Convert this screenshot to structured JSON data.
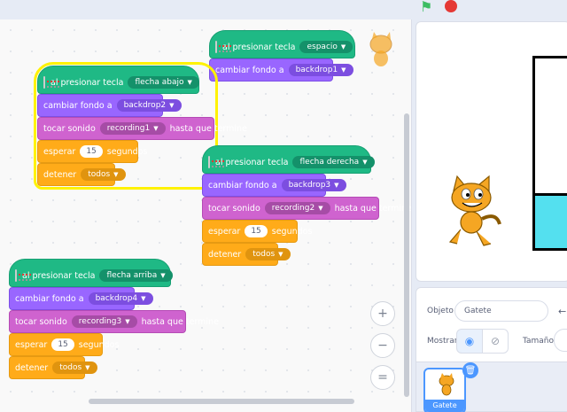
{
  "workspace": {
    "stack1": {
      "hat_label": "al presionar tecla",
      "hat_key": "espacio",
      "look_label": "cambiar fondo a",
      "look_value": "backdrop1"
    },
    "stack2": {
      "hat_label": "al presionar tecla",
      "hat_key": "flecha abajo",
      "look_label": "cambiar fondo a",
      "look_value": "backdrop2",
      "sound_label": "tocar sonido",
      "sound_value": "recording1",
      "sound_suffix": "hasta que termine",
      "wait_label": "esperar",
      "wait_value": "15",
      "wait_suffix": "segundos",
      "stop_label": "detener",
      "stop_value": "todos"
    },
    "stack3": {
      "hat_label": "al presionar tecla",
      "hat_key": "flecha derecha",
      "look_label": "cambiar fondo a",
      "look_value": "backdrop3",
      "sound_label": "tocar sonido",
      "sound_value": "recording2",
      "sound_suffix": "hasta que termine",
      "wait_label": "esperar",
      "wait_value": "15",
      "wait_suffix": "segundos",
      "stop_label": "detener",
      "stop_value": "todos"
    },
    "stack4": {
      "hat_label": "al presionar tecla",
      "hat_key": "flecha arriba",
      "look_label": "cambiar fondo a",
      "look_value": "backdrop4",
      "sound_label": "tocar sonido",
      "sound_value": "recording3",
      "sound_suffix": "hasta que termine",
      "wait_label": "esperar",
      "wait_value": "15",
      "wait_suffix": "segundos",
      "stop_label": "detener",
      "stop_value": "todos"
    },
    "zoom": {
      "in": "+",
      "out": "−",
      "reset": "="
    }
  },
  "sprite_panel": {
    "object_label": "Objeto",
    "object_name": "Gatete",
    "show_label": "Mostrar",
    "size_label": "Tamaño",
    "sprite_thumb_label": "Gatete"
  },
  "colors": {
    "events": "#1fb985",
    "looks": "#9966ff",
    "sound": "#cf63cf",
    "control": "#ffab19",
    "highlight": "#fff200"
  }
}
